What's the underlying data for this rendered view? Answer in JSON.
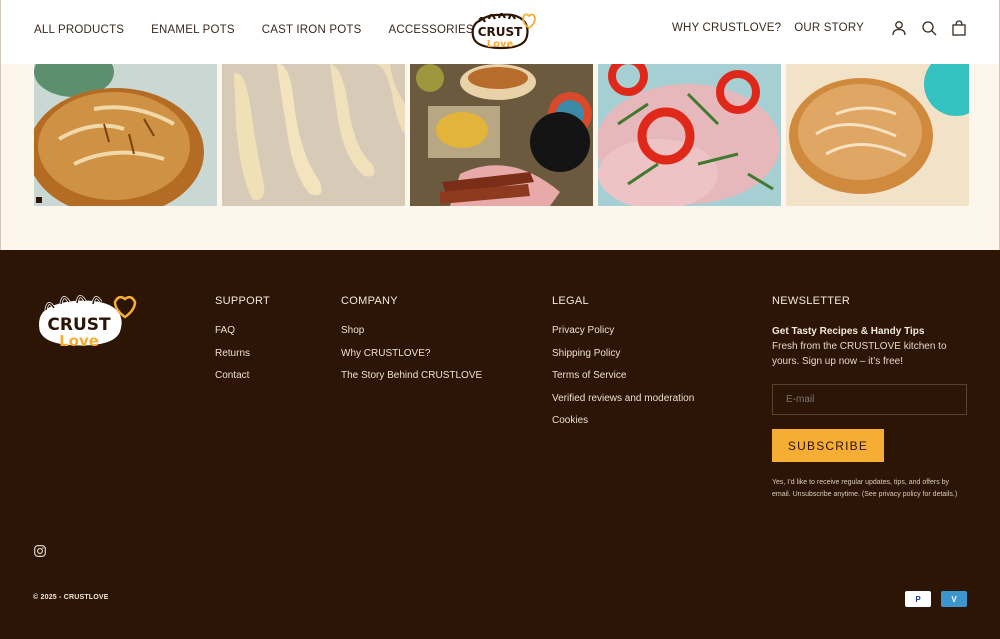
{
  "header": {
    "nav_left": [
      "ALL PRODUCTS",
      "ENAMEL POTS",
      "CAST IRON POTS",
      "ACCESSORIES"
    ],
    "nav_right": [
      "WHY CRUSTLOVE?",
      "OUR STORY"
    ],
    "logo_text": [
      "CRUST",
      "Love"
    ]
  },
  "footer": {
    "logo_text": [
      "CRUST",
      "Love"
    ],
    "support": {
      "title": "SUPPORT",
      "links": [
        "FAQ",
        "Returns",
        "Contact"
      ]
    },
    "company": {
      "title": "COMPANY",
      "links": [
        "Shop",
        "Why CRUSTLOVE?",
        "The Story Behind CRUSTLOVE"
      ]
    },
    "legal": {
      "title": "LEGAL",
      "links": [
        "Privacy Policy",
        "Shipping Policy",
        "Terms of Service",
        "Verified reviews and moderation",
        "Cookies"
      ]
    },
    "newsletter": {
      "title": "NEWSLETTER",
      "heading": "Get Tasty Recipes & Handy Tips",
      "text": "Fresh from the CRUSTLOVE kitchen to yours. Sign up now – it’s free!",
      "email_placeholder": "E-mail",
      "button": "SUBSCRIBE",
      "consent": "Yes, I’d like to receive regular updates, tips, and offers by email. Unsubscribe anytime. (See privacy policy for details.)"
    },
    "copyright": "© 2025 - CRUSTLOVE",
    "payment_icons": [
      "P",
      "V"
    ]
  },
  "colors": {
    "footer_bg": "#2d1505",
    "accent": "#f5ad33",
    "cream": "#fdf6ec"
  }
}
